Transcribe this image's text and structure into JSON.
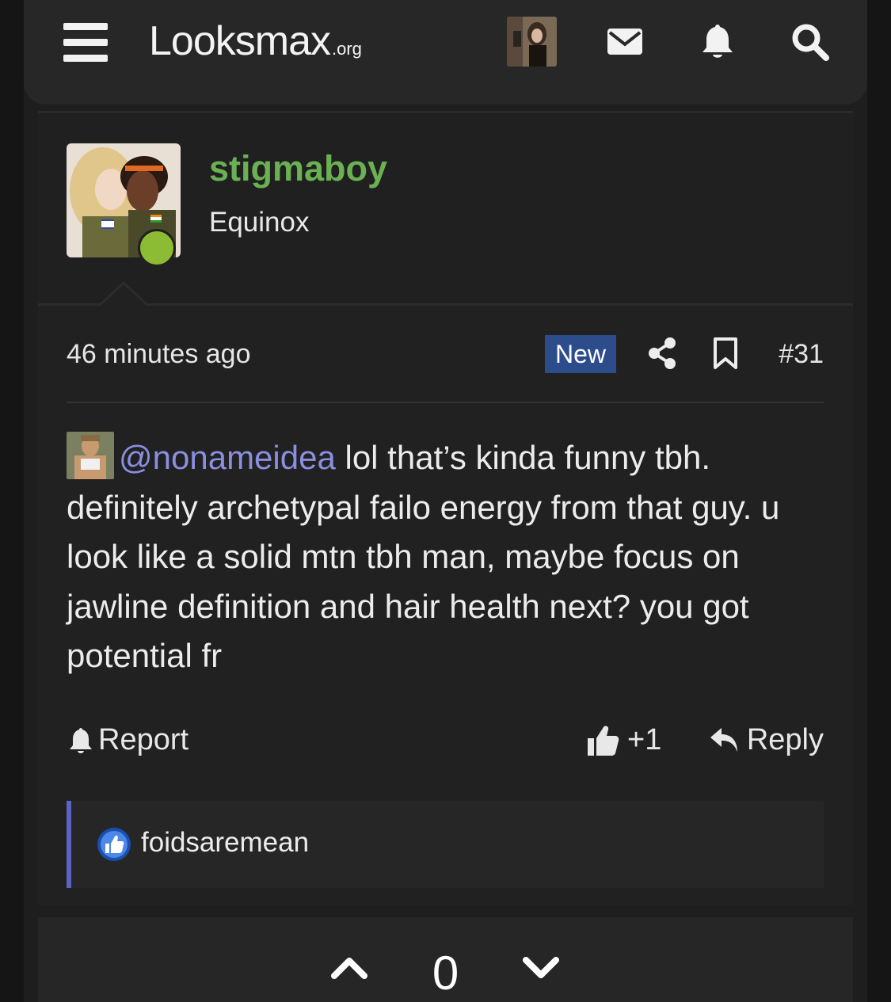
{
  "header": {
    "logo_main": "Looksmax",
    "logo_tld": ".org",
    "icons": [
      "menu-icon",
      "envelope-icon",
      "bell-icon",
      "search-icon"
    ]
  },
  "post": {
    "username": "stigmaboy",
    "user_title": "Equinox",
    "username_color": "#69b152",
    "timestamp": "46 minutes ago",
    "new_badge": "New",
    "post_number": "#31",
    "mention": "@nonameidea",
    "body_text": " lol that’s kinda funny tbh. definitely archetypal failo energy from that guy. u look like a solid mtn tbh man, maybe focus on jawline definition and hair health next? you got potential fr",
    "mention_color": "#8a8fe0",
    "actions": {
      "report": "Report",
      "like_count": "+1",
      "reply": "Reply"
    },
    "reactions": {
      "user": "foidsaremean",
      "reaction_type": "like"
    }
  },
  "vote": {
    "count": "0"
  },
  "colors": {
    "accent_badge": "#2c4c8c",
    "online": "#8cbc34",
    "reaction_border": "#5b63c8"
  }
}
